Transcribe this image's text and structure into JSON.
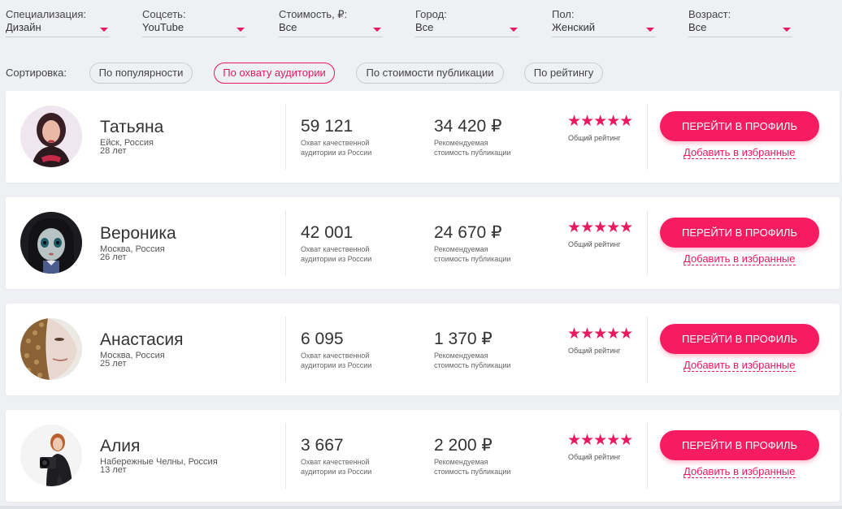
{
  "filters": [
    {
      "label": "Специализация:",
      "value": "Дизайн"
    },
    {
      "label": "Соцсеть:",
      "value": "YouTube"
    },
    {
      "label": "Стоимость, ₽:",
      "value": "Все"
    },
    {
      "label": "Город:",
      "value": "Все"
    },
    {
      "label": "Пол:",
      "value": "Женский"
    },
    {
      "label": "Возраст:",
      "value": "Все"
    }
  ],
  "sort": {
    "label": "Сортировка:",
    "options": [
      "По популярности",
      "По охвату аудитории",
      "По стоимости публикации",
      "По рейтингу"
    ],
    "active": "По охвату аудитории"
  },
  "captions": {
    "reach": "Охват качественной аудитории из России",
    "price": "Рекомендуемая стоимость публикации",
    "rating": "Общий рейтинг",
    "profile_button": "ПЕРЕЙТИ В ПРОФИЛЬ",
    "favorite_link": "Добавить в избранные"
  },
  "bloggers": [
    {
      "name": "Татьяна",
      "city": "Ейск, Россия",
      "age": "28 лет",
      "reach": "59 121",
      "price": "34 420 ₽",
      "stars": "★★★★★",
      "rating": 5
    },
    {
      "name": "Вероника",
      "city": "Москва, Россия",
      "age": "26 лет",
      "reach": "42 001",
      "price": "24 670 ₽",
      "stars": "★★★★★",
      "rating": 5
    },
    {
      "name": "Анастасия",
      "city": "Москва, Россия",
      "age": "25 лет",
      "reach": "6 095",
      "price": "1 370 ₽",
      "stars": "★★★★★",
      "rating": 5
    },
    {
      "name": "Алия",
      "city": "Набережные Челны, Россия",
      "age": "13 лет",
      "reach": "3 667",
      "price": "2 200 ₽",
      "stars": "★★★★★",
      "rating": 5
    }
  ],
  "colors": {
    "accent": "#e8195f",
    "button": "#f71b62",
    "background": "#eef0f4",
    "card": "#ffffff"
  }
}
